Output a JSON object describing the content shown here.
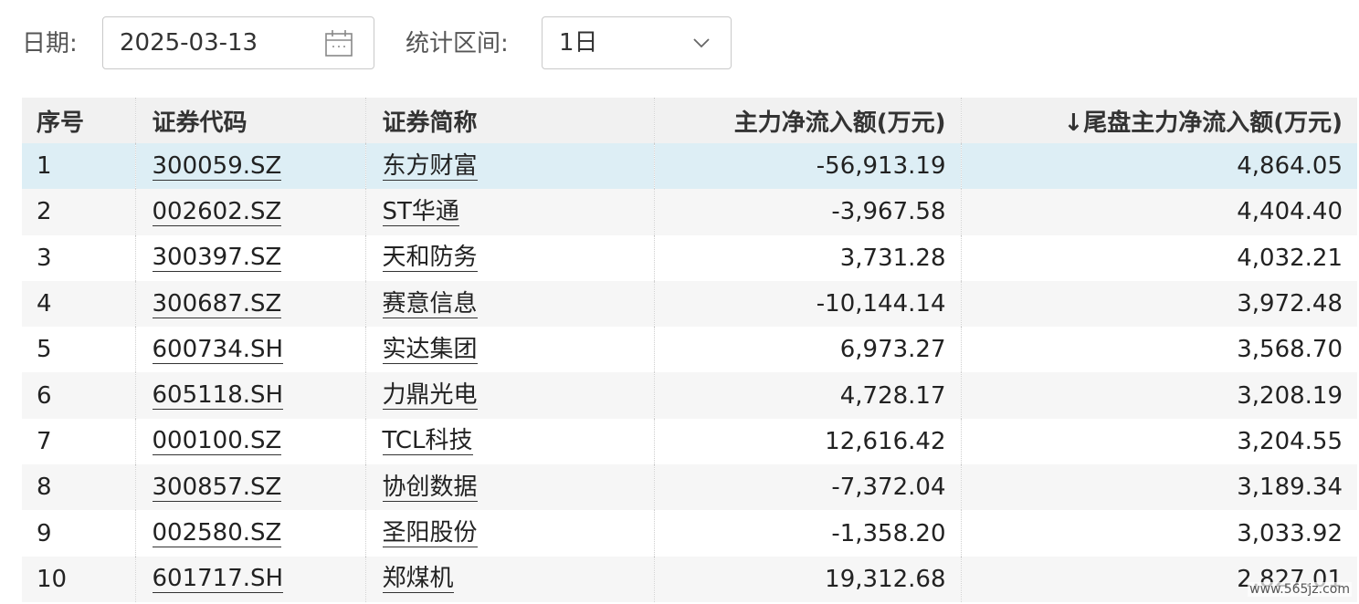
{
  "filters": {
    "date_label": "日期:",
    "date_value": "2025-03-13",
    "period_label": "统计区间:",
    "period_value": "1日"
  },
  "table": {
    "headers": {
      "index": "序号",
      "code": "证券代码",
      "name": "证券简称",
      "main_flow": "主力净流入额(万元)",
      "tail_flow": "↓尾盘主力净流入额(万元)"
    },
    "rows": [
      {
        "index": "1",
        "code": "300059.SZ",
        "name": "东方财富",
        "main_flow": "-56,913.19",
        "tail_flow": "4,864.05"
      },
      {
        "index": "2",
        "code": "002602.SZ",
        "name": "ST华通",
        "main_flow": "-3,967.58",
        "tail_flow": "4,404.40"
      },
      {
        "index": "3",
        "code": "300397.SZ",
        "name": "天和防务",
        "main_flow": "3,731.28",
        "tail_flow": "4,032.21"
      },
      {
        "index": "4",
        "code": "300687.SZ",
        "name": "赛意信息",
        "main_flow": "-10,144.14",
        "tail_flow": "3,972.48"
      },
      {
        "index": "5",
        "code": "600734.SH",
        "name": "实达集团",
        "main_flow": "6,973.27",
        "tail_flow": "3,568.70"
      },
      {
        "index": "6",
        "code": "605118.SH",
        "name": "力鼎光电",
        "main_flow": "4,728.17",
        "tail_flow": "3,208.19"
      },
      {
        "index": "7",
        "code": "000100.SZ",
        "name": "TCL科技",
        "main_flow": "12,616.42",
        "tail_flow": "3,204.55"
      },
      {
        "index": "8",
        "code": "300857.SZ",
        "name": "协创数据",
        "main_flow": "-7,372.04",
        "tail_flow": "3,189.34"
      },
      {
        "index": "9",
        "code": "002580.SZ",
        "name": "圣阳股份",
        "main_flow": "-1,358.20",
        "tail_flow": "3,033.92"
      },
      {
        "index": "10",
        "code": "601717.SH",
        "name": "郑煤机",
        "main_flow": "19,312.68",
        "tail_flow": "2,827.01"
      }
    ]
  },
  "watermark": "www.565jz.com"
}
